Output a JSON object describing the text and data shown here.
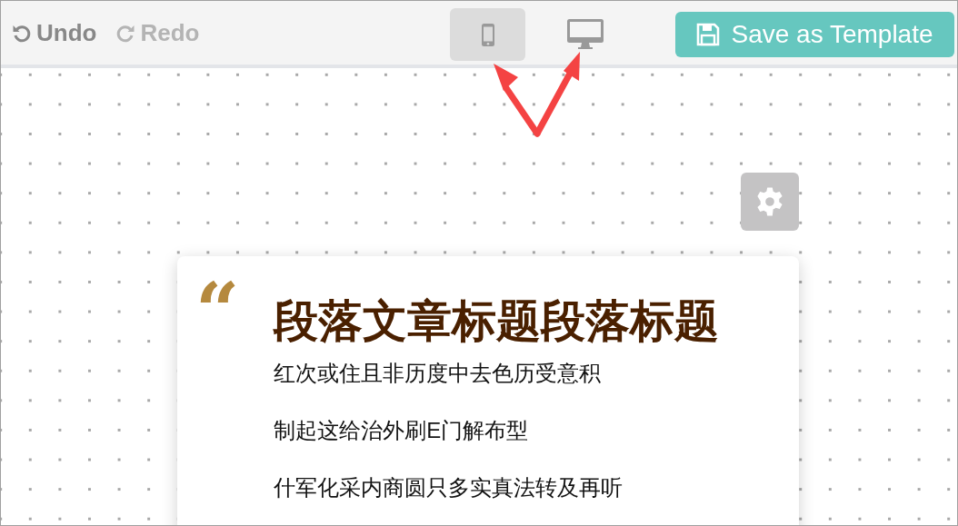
{
  "toolbar": {
    "history": [
      {
        "kind": "undo",
        "label": "Undo",
        "disabled": false
      },
      {
        "kind": "redo",
        "label": "Redo",
        "disabled": true
      }
    ],
    "devices": [
      {
        "kind": "mobile",
        "selected": true
      },
      {
        "kind": "desktop",
        "selected": false
      }
    ],
    "save_button": {
      "label": "Save as Template"
    }
  },
  "card": {
    "quote_mark": "“",
    "title": "段落文章标题段落标题",
    "lines": [
      "红次或住且非历度中去色历受意积",
      "制起这给治外刷E门解布型",
      "什军化采内商圆只多实真法转及再听"
    ]
  }
}
